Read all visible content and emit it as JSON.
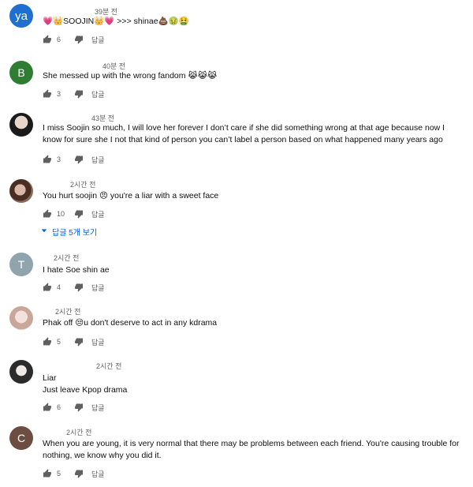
{
  "comments": [
    {
      "avatar_text": "ya",
      "time": "39분 전",
      "text": "💗👑SOOJIN👑💗 >>> shinae💩🤢🤮",
      "likes": "6",
      "reply_label": "답글"
    },
    {
      "avatar_text": "B",
      "time": "40분 전",
      "text": "She messed up with the wrong fandom 😹😹😹",
      "likes": "3",
      "reply_label": "답글"
    },
    {
      "avatar_text": "",
      "time": "43분 전",
      "text": "I miss Soojin so much, I will love her forever I don’t care if she did something wrong at that age because now I know for sure she I not that kind of person you can’t label a person based on what happened many years ago",
      "likes": "3",
      "reply_label": "답글"
    },
    {
      "avatar_text": "",
      "time": "2시간 전",
      "text": "You hurt soojin 😠 you're a liar with a sweet face",
      "likes": "10",
      "reply_label": "답글",
      "replies_label": "답글 5개 보기"
    },
    {
      "avatar_text": "T",
      "time": "2시간 전",
      "text": "I hate Soe shin ae",
      "likes": "4",
      "reply_label": "답글"
    },
    {
      "avatar_text": "",
      "time": "2시간 전",
      "text": "Phak off 😒u don't deserve to act in any kdrama",
      "likes": "5",
      "reply_label": "답글"
    },
    {
      "avatar_text": "",
      "time": "2시간 전",
      "text_line1": "Liar",
      "text_line2": "Just leave Kpop drama",
      "likes": "6",
      "reply_label": "답글"
    },
    {
      "avatar_text": "C",
      "time": "2시간 전",
      "text": "When you are young, it is very normal that there may be problems between each friend. You're causing trouble for nothing, we know why you did it.",
      "likes": "5",
      "reply_label": "답글"
    }
  ],
  "icons": {
    "like": "thumbs-up-icon",
    "dislike": "thumbs-down-icon",
    "expand": "caret-down-icon"
  },
  "colors": {
    "link_blue": "#065fd4",
    "meta_gray": "#606060"
  }
}
